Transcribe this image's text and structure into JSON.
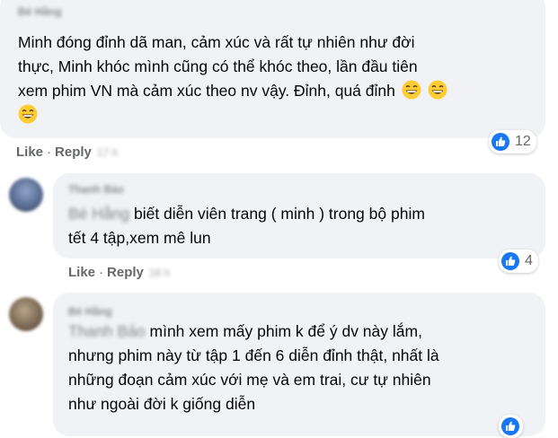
{
  "comments": [
    {
      "author": "Bé Hằng",
      "lines": [
        "Minh đóng đỉnh dã man, cảm xúc và rất tự nhiên như đời",
        "thực, Minh khóc mình cũng có thể khóc theo, lần đầu tiên",
        "xem phim VN mà cảm xúc theo nv vậy. Đỉnh, quá đỉnh"
      ],
      "like_label": "Like",
      "reply_label": "Reply",
      "time": "17 h",
      "reaction_count": "12"
    },
    {
      "author": "Thanh Bảo",
      "mention": "Bé Hằng",
      "lines": [
        "biết diễn viên trang ( minh ) trong bộ phim",
        "tết 4 tập,xem mê lun"
      ],
      "like_label": "Like",
      "reply_label": "Reply",
      "time": "16 h",
      "reaction_count": "4"
    },
    {
      "author": "Bé Hằng",
      "mention": "Thanh Bảo",
      "lines": [
        "mình xem mấy phim k để ý dv này lắm,",
        "nhưng phim này từ tập 1 đến 6 diễn đỉnh thật, nhất là",
        "những đoạn cảm xúc với mẹ và em trai, cư tự nhiên",
        "như ngoài đời k giống diễn"
      ]
    }
  ],
  "icons": {
    "like": "like-reaction-icon",
    "grin": "grinning-face-emoji"
  },
  "colors": {
    "bubble": "#f0f2f5",
    "like_blue": "#1877f2",
    "muted_text": "#65676b"
  }
}
